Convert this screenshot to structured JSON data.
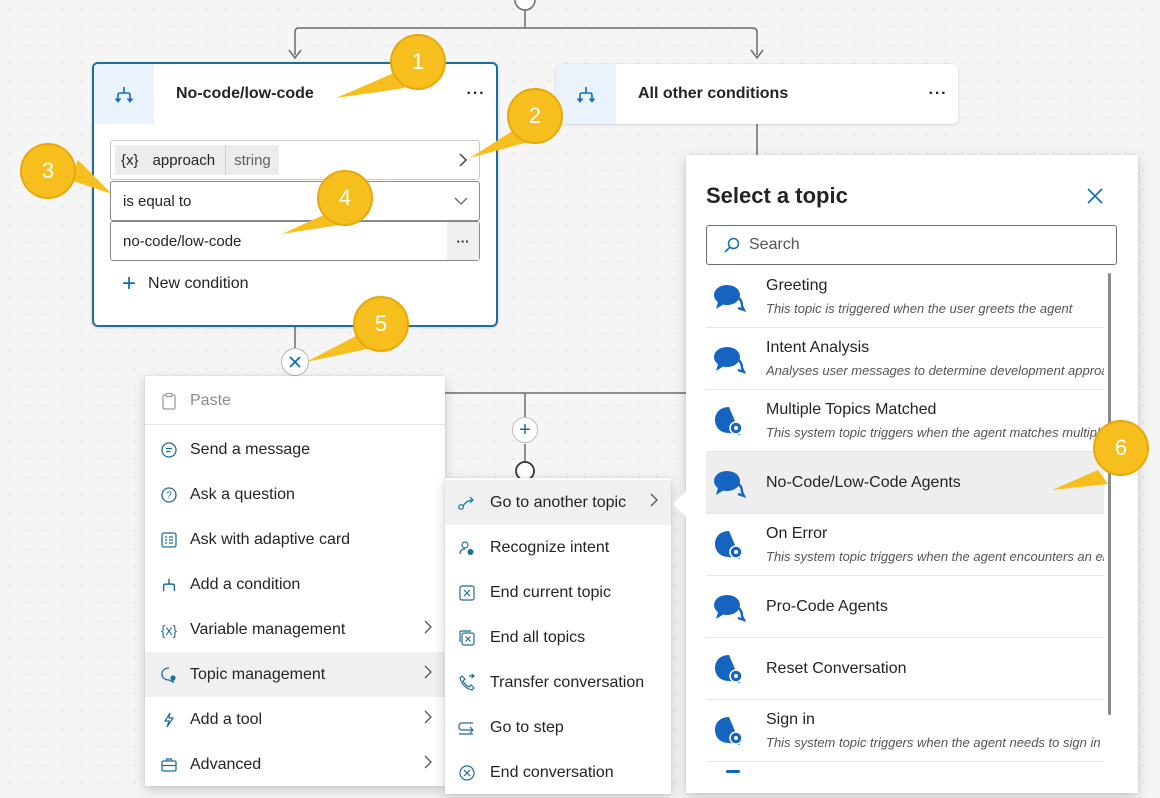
{
  "canvas": {
    "condition_left": {
      "title": "No-code/low-code",
      "variable_chip": "{x}",
      "variable_name": "approach",
      "variable_type": "string",
      "operator": "is equal to",
      "value": "no-code/low-code",
      "value_more": "···",
      "new_condition": "New condition",
      "more": "···"
    },
    "condition_right": {
      "title": "All other conditions",
      "more": "···"
    }
  },
  "node_menu": {
    "items": [
      {
        "label": "Paste",
        "icon": "clipboard-icon",
        "disabled": true
      },
      {
        "label": "Send a message",
        "icon": "message-icon"
      },
      {
        "label": "Ask a question",
        "icon": "question-icon"
      },
      {
        "label": "Ask with adaptive card",
        "icon": "card-icon"
      },
      {
        "label": "Add a condition",
        "icon": "branch-icon"
      },
      {
        "label": "Variable management",
        "icon": "variable-icon",
        "submenu": true
      },
      {
        "label": "Topic management",
        "icon": "topic-icon",
        "submenu": true,
        "active": true
      },
      {
        "label": "Add a tool",
        "icon": "tool-icon",
        "submenu": true
      },
      {
        "label": "Advanced",
        "icon": "briefcase-icon",
        "submenu": true
      }
    ]
  },
  "topic_submenu": {
    "items": [
      {
        "label": "Go to another topic",
        "icon": "redirect-icon",
        "submenu": true,
        "active": true
      },
      {
        "label": "Recognize intent",
        "icon": "intent-icon"
      },
      {
        "label": "End current topic",
        "icon": "end-topic-icon"
      },
      {
        "label": "End all topics",
        "icon": "end-all-icon"
      },
      {
        "label": "Transfer conversation",
        "icon": "phone-transfer-icon"
      },
      {
        "label": "Go to step",
        "icon": "go-to-step-icon"
      },
      {
        "label": "End conversation",
        "icon": "end-conversation-icon"
      }
    ]
  },
  "select_topic": {
    "title": "Select a topic",
    "search_placeholder": "Search",
    "topics": [
      {
        "name": "Greeting",
        "desc": "This topic is triggered when the user greets the agent",
        "icon": "chat-bubble-icon"
      },
      {
        "name": "Intent Analysis",
        "desc": "Analyses user messages to determine development approach",
        "icon": "chat-bubble-icon"
      },
      {
        "name": "Multiple Topics Matched",
        "desc": "This system topic triggers when the agent matches multiple topics",
        "icon": "system-topic-icon"
      },
      {
        "name": "No-Code/Low-Code Agents",
        "desc": "",
        "icon": "chat-bubble-icon",
        "active": true
      },
      {
        "name": "On Error",
        "desc": "This system topic triggers when the agent encounters an error",
        "icon": "system-topic-icon"
      },
      {
        "name": "Pro-Code Agents",
        "desc": "",
        "icon": "chat-bubble-icon"
      },
      {
        "name": "Reset Conversation",
        "desc": "",
        "icon": "system-topic-icon"
      },
      {
        "name": "Sign in",
        "desc": "This system topic triggers when the agent needs to sign in the user",
        "icon": "system-topic-icon"
      }
    ]
  },
  "callouts": [
    "1",
    "2",
    "3",
    "4",
    "5",
    "6"
  ],
  "colors": {
    "accent": "#1e6e9a",
    "callout": "#f7bf1e",
    "icon_blue": "#0f6cbd"
  }
}
